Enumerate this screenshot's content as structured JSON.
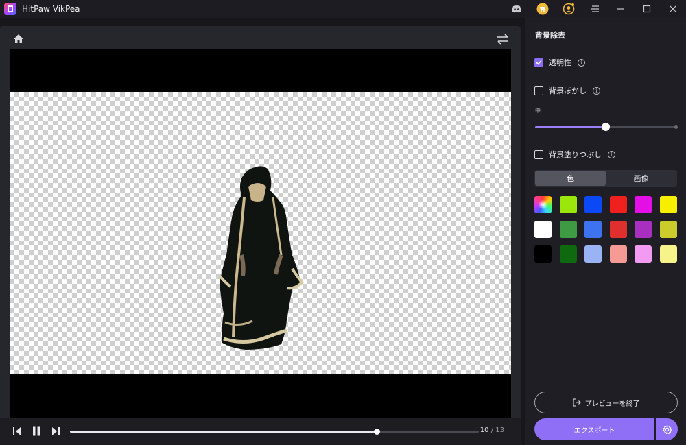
{
  "app": {
    "title": "HitPaw VikPea"
  },
  "titlebar": {
    "icons": [
      "discord-icon",
      "cart-icon",
      "account-icon",
      "menu-icon"
    ],
    "window_controls": [
      "minimize-icon",
      "maximize-icon",
      "close-icon"
    ]
  },
  "player": {
    "top_icons": [
      "home-icon",
      "swap-icon"
    ],
    "controls": {
      "icons": [
        "prev-frame-icon",
        "pause-icon",
        "next-frame-icon"
      ],
      "current_frame": "10",
      "separator": " / ",
      "total_frames": "13",
      "progress": 0.75
    }
  },
  "side": {
    "title": "背景除去",
    "transparency": {
      "label": "透明性",
      "checked": true
    },
    "blur": {
      "label": "背景ぼかし",
      "checked": false,
      "level_label": "中",
      "level": 0.5
    },
    "fill": {
      "label": "背景塗りつぶし",
      "checked": false
    },
    "tabs": [
      {
        "label": "色",
        "active": true
      },
      {
        "label": "画像",
        "active": false
      }
    ],
    "swatches": [
      [
        "rainbow",
        "#9be60b",
        "#0a49f5",
        "#f0201f",
        "#e40fe6",
        "#f8ef00"
      ],
      [
        "#ffffff",
        "#3f9a44",
        "#3d73f0",
        "#e02f2f",
        "#a92fc0",
        "#cbcb2c"
      ],
      [
        "#000000",
        "#0f6a0f",
        "#9ab3f4",
        "#f69a95",
        "#f39af3",
        "#f6f38a"
      ]
    ],
    "preview_button": "プレビューを終了",
    "export_button": "エクスポート"
  }
}
